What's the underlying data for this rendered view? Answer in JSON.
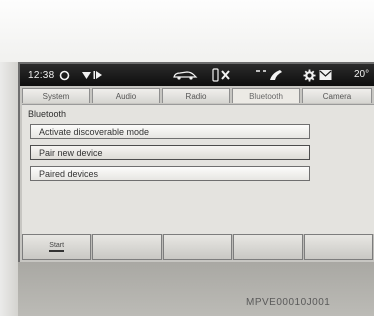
{
  "statusbar": {
    "time": "12:38",
    "temperature": "20°",
    "icons": [
      "clock-circle-icon",
      "wifi-signal-icon",
      "play-icon",
      "car-icon",
      "phone-disabled-icon",
      "phone-handset-icon",
      "gear-icon",
      "envelope-icon"
    ]
  },
  "tabs": [
    "System",
    "Audio",
    "Radio",
    "Bluetooth",
    "Camera"
  ],
  "active_tab": "Bluetooth",
  "section_title": "Bluetooth",
  "menu": {
    "items": [
      "Activate discoverable mode",
      "Pair new device",
      "Paired devices"
    ]
  },
  "softkeys": [
    "Start",
    "",
    "",
    "",
    ""
  ],
  "reference_code": "MPVE00010J001"
}
